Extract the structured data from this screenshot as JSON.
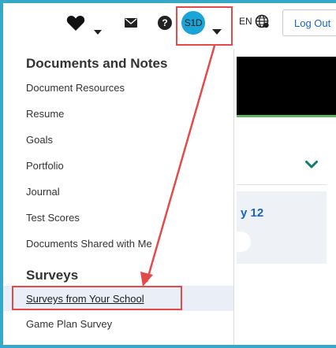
{
  "header": {
    "avatar_initials": "S1D",
    "language": "EN",
    "logout_label": "Log Out",
    "help_glyph": "?"
  },
  "background": {
    "date_text": "y 12"
  },
  "menu": {
    "documents_heading": "Documents and Notes",
    "documents_items": [
      "Document Resources",
      "Resume",
      "Goals",
      "Portfolio",
      "Journal",
      "Test Scores",
      "Documents Shared with Me"
    ],
    "surveys_heading": "Surveys",
    "surveys_items": [
      "Surveys from Your School",
      "Game Plan Survey"
    ]
  },
  "colors": {
    "accent": "#e34b4b",
    "link": "#1766c1",
    "avatar": "#1aa5d8",
    "border_frame": "#35a9c7"
  },
  "icons": [
    "heart-icon",
    "mail-icon",
    "help-icon",
    "globe-icon",
    "chevron-down-icon"
  ]
}
